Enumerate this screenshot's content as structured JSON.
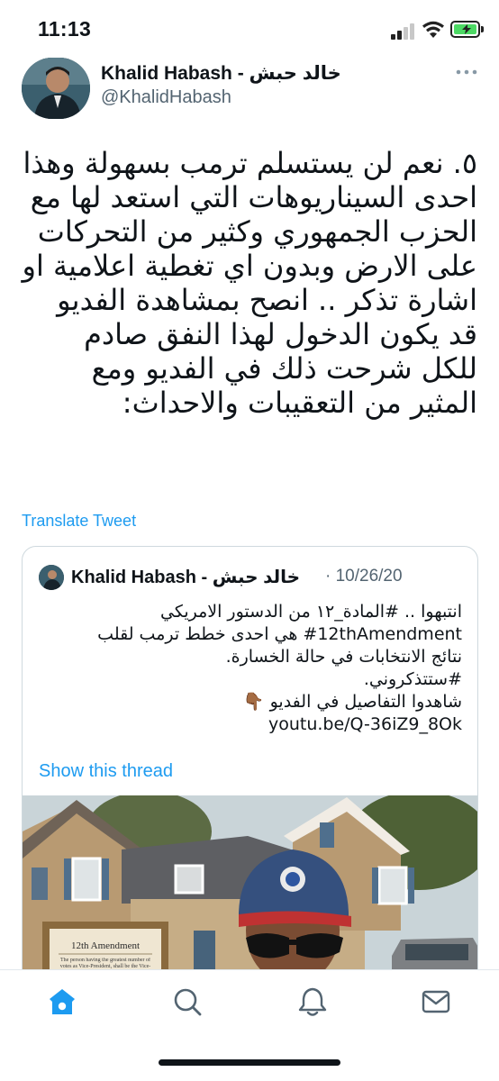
{
  "status_bar": {
    "time": "11:13"
  },
  "tweet": {
    "display_name": "Khalid Habash - خالد حبش",
    "handle": "@KhalidHabash",
    "text": "٥. نعم لن يستسلم ترمب بسهولة وهذا احدى السيناريوهات التي استعد لها مع الحزب الجمهوري وكثير من التحركات على الارض وبدون اي تغطية اعلامية او اشارة تذكر .. انصح بمشاهدة الفديو قد يكون الدخول لهذا النفق صادم للكل شرحت ذلك في الفديو ومع المثير من التعقيبات والاحداث:",
    "translate_label": "Translate Tweet"
  },
  "quoted_tweet": {
    "display_name": "Khalid Habash - خالد حبش",
    "date": "· 10/26/20",
    "lines": [
      "انتبهوا .. #المادة_١٢ من الدستور الامريكي",
      "#12thAmendment هي احدى خطط ترمب لقلب",
      "نتائج الانتخابات في حالة الخسارة.",
      "#ستتذكروني.",
      "شاهدوا التفاصيل في الفديو 👇🏾",
      "youtu.be/Q-36iZ9_8Ok"
    ],
    "show_thread_label": "Show this thread",
    "media_sign_title": "12th Amendment",
    "media_sign_body": "The person having the greatest number of votes as Vice-President, shall be the Vice-"
  },
  "tab_bar": {
    "tabs": [
      {
        "icon": "home-icon",
        "active": true
      },
      {
        "icon": "search-icon",
        "active": false
      },
      {
        "icon": "bell-icon",
        "active": false
      },
      {
        "icon": "mail-icon",
        "active": false
      }
    ]
  },
  "colors": {
    "accent": "#1d9bf0",
    "text": "#0f1419",
    "secondary": "#536471",
    "border": "#cfd9de"
  }
}
